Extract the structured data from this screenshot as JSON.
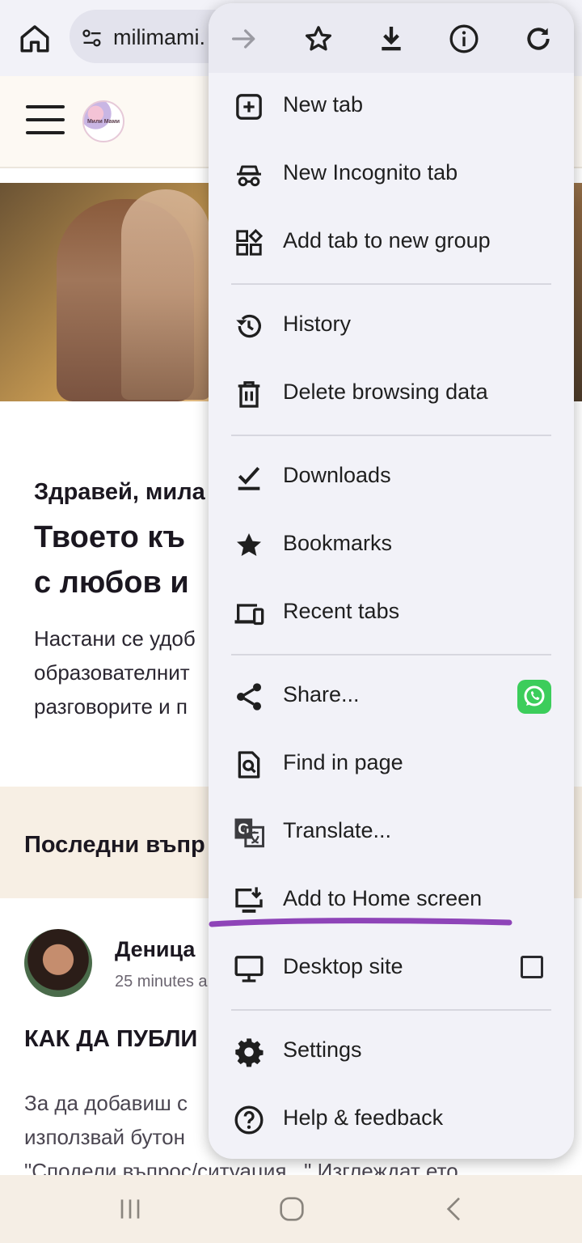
{
  "toolbar": {
    "url": "milimami.",
    "icons": [
      "home-icon",
      "site-settings-icon",
      "forward-icon",
      "bookmark-star-icon",
      "download-icon",
      "info-icon",
      "reload-icon"
    ]
  },
  "page": {
    "logo_text": "Мили Мами",
    "greeting": "Здравей, мила",
    "headline_line1": "Твоето къ",
    "headline_line2": "с любов и",
    "body_line1": "Настани се удоб",
    "body_line2": "образователнит",
    "body_line3": "разговорите и п",
    "questions_heading": "Последни въпр",
    "post_author": "Деница",
    "post_time": "25 minutes a",
    "post_title": "КАК ДА ПУБЛИ",
    "post_line1": "За да добавиш с",
    "post_line2": "използвай бутон",
    "post_line3": "\"Сподели въпрос/ситуация...\" Изглеждат ето"
  },
  "menu": {
    "items": [
      {
        "label": "New tab",
        "icon": "new-tab-icon"
      },
      {
        "label": "New Incognito tab",
        "icon": "incognito-icon"
      },
      {
        "label": "Add tab to new group",
        "icon": "tab-group-icon"
      },
      {
        "label": "History",
        "icon": "history-icon"
      },
      {
        "label": "Delete browsing data",
        "icon": "trash-icon"
      },
      {
        "label": "Downloads",
        "icon": "downloads-check-icon"
      },
      {
        "label": "Bookmarks",
        "icon": "star-icon"
      },
      {
        "label": "Recent tabs",
        "icon": "devices-icon"
      },
      {
        "label": "Share...",
        "icon": "share-icon"
      },
      {
        "label": "Find in page",
        "icon": "find-in-page-icon"
      },
      {
        "label": "Translate...",
        "icon": "translate-icon"
      },
      {
        "label": "Add to Home screen",
        "icon": "add-to-home-icon"
      },
      {
        "label": "Desktop site",
        "icon": "desktop-icon"
      },
      {
        "label": "Settings",
        "icon": "gear-icon"
      },
      {
        "label": "Help & feedback",
        "icon": "help-icon"
      }
    ],
    "desktop_site_checked": false,
    "highlight_color": "#8e44b8",
    "whatsapp_color": "#3ccd5b"
  },
  "navbar": {
    "icons": [
      "recents-icon",
      "home-circle-icon",
      "back-icon"
    ]
  }
}
